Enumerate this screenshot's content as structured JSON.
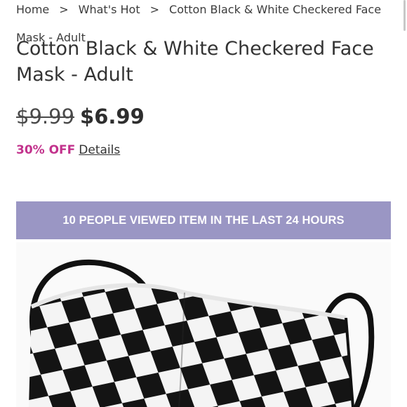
{
  "breadcrumb": {
    "items": [
      "Home",
      "What's Hot",
      "Cotton Black & White Checkered Face Mask - Adult"
    ],
    "separator": ">"
  },
  "product": {
    "title": "Cotton Black & White Checkered Face Mask - Adult",
    "original_price": "$9.99",
    "sale_price": "$6.99",
    "discount_label": "30% OFF",
    "details_link": "Details",
    "image_icon": "checkered-face-mask-photo"
  },
  "banner": {
    "text": "10 PEOPLE VIEWED ITEM IN THE LAST 24 HOURS"
  },
  "colors": {
    "discount": "#c2328c",
    "banner_bg": "#9a96c4",
    "banner_text": "#ffffff",
    "text": "#333333"
  }
}
